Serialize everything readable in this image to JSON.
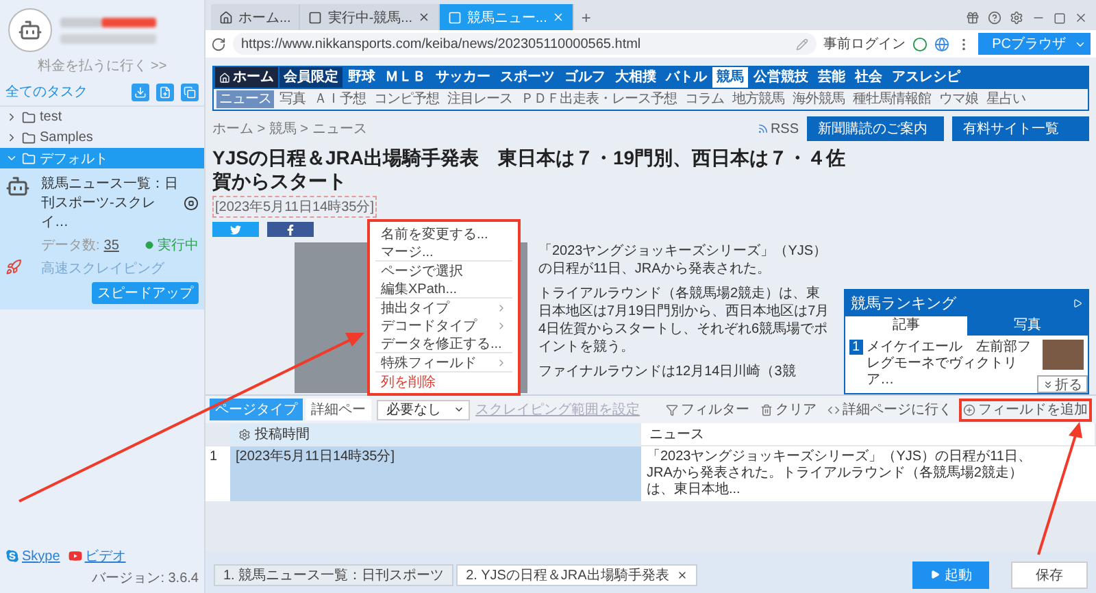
{
  "sidebar": {
    "account": {
      "link": "料金を払うに行く >>"
    },
    "task_header": {
      "title": "全てのタスク"
    },
    "tree": [
      {
        "label": "test",
        "expanded": false,
        "selected": false
      },
      {
        "label": "Samples",
        "expanded": false,
        "selected": false
      },
      {
        "label": "デフォルト",
        "expanded": true,
        "selected": true
      }
    ],
    "task": {
      "name": "競馬ニュース一覧：日刊スポーツ-スクレイ…",
      "data_label": "データ数:",
      "data_count": "35",
      "status": "実行中",
      "mode": "高速スクレイピング",
      "boost_button": "スピードアップ"
    },
    "footer": {
      "links": [
        {
          "label": "Skype",
          "kind": "skype"
        },
        {
          "label": "ビデオ",
          "kind": "video"
        }
      ],
      "version": "バージョン: 3.6.4"
    }
  },
  "browser": {
    "tabs": [
      {
        "label": "ホーム...",
        "kind": "home",
        "selected": false,
        "closable": false
      },
      {
        "label": "実行中-競馬...",
        "kind": "page",
        "selected": false,
        "closable": true
      },
      {
        "label": "競馬ニュー...",
        "kind": "page",
        "selected": true,
        "closable": true
      }
    ],
    "new_tab": "+",
    "url": "https://www.nikkansports.com/keiba/news/202305110000565.html",
    "prelogin": "事前ログイン",
    "mode_button": "PCブラウザ"
  },
  "article": {
    "nav_main": [
      {
        "label": "ホーム",
        "kind": "home",
        "selected": false
      },
      {
        "label": "会員限定",
        "kind": "member",
        "selected": false
      },
      {
        "label": "野球",
        "kind": "plain",
        "selected": false
      },
      {
        "label": "ＭＬＢ",
        "kind": "plain",
        "selected": false
      },
      {
        "label": "サッカー",
        "kind": "plain",
        "selected": false
      },
      {
        "label": "スポーツ",
        "kind": "plain",
        "selected": false
      },
      {
        "label": "ゴルフ",
        "kind": "plain",
        "selected": false
      },
      {
        "label": "大相撲",
        "kind": "plain",
        "selected": false
      },
      {
        "label": "バトル",
        "kind": "plain",
        "selected": false
      },
      {
        "label": "競馬",
        "kind": "plain",
        "selected": true
      },
      {
        "label": "公営競技",
        "kind": "plain",
        "selected": false
      },
      {
        "label": "芸能",
        "kind": "plain",
        "selected": false
      },
      {
        "label": "社会",
        "kind": "plain",
        "selected": false
      },
      {
        "label": "アスレシピ",
        "kind": "plain",
        "selected": false
      }
    ],
    "nav_sub": [
      {
        "label": "ニュース",
        "selected": true
      },
      {
        "label": "写真",
        "selected": false
      },
      {
        "label": "ＡＩ予想",
        "selected": false
      },
      {
        "label": "コンピ予想",
        "selected": false
      },
      {
        "label": "注目レース",
        "selected": false
      },
      {
        "label": "ＰＤＦ出走表・レース予想",
        "selected": false
      },
      {
        "label": "コラム",
        "selected": false
      },
      {
        "label": "地方競馬",
        "selected": false
      },
      {
        "label": "海外競馬",
        "selected": false
      },
      {
        "label": "種牡馬情報館",
        "selected": false
      },
      {
        "label": "ウマ娘",
        "selected": false
      },
      {
        "label": "星占い",
        "selected": false
      }
    ],
    "breadcrumb": "ホーム > 競馬 > ニュース",
    "rss": "RSS",
    "promo_links": [
      "新聞購読のご案内",
      "有料サイト一覧"
    ],
    "title": "YJSの日程＆JRA出場騎手発表　東日本は７・19門別、西日本は７・４佐賀からスタート",
    "date": "[2023年5月11日14時35分]",
    "paragraphs": [
      "「2023ヤングジョッキーズシリーズ」（YJS）の日程が11日、JRAから発表された。",
      "トライアルラウンド（各競馬場2競走）は、東日本地区は7月19日門別から、西日本地区は7月4日佐賀からスタートし、それぞれ6競馬場でポイントを競う。",
      "ファイナルラウンドは12月14日川崎（3競"
    ],
    "ranking": {
      "title": "競馬ランキング",
      "tabs": [
        {
          "label": "記事",
          "selected": true
        },
        {
          "label": "写真",
          "selected": false
        }
      ],
      "items": [
        {
          "rank": "1",
          "title": "メイケイエール　左前部フレグモーネでヴィクトリア…"
        }
      ]
    }
  },
  "context_menu": {
    "highlighted": true,
    "groups": [
      [
        {
          "label": "名前を変更する...",
          "submenu": false,
          "danger": false
        },
        {
          "label": "マージ...",
          "submenu": false,
          "danger": false
        }
      ],
      [
        {
          "label": "ページで選択",
          "submenu": false,
          "danger": false
        },
        {
          "label": "編集XPath...",
          "submenu": false,
          "danger": false
        }
      ],
      [
        {
          "label": "抽出タイプ",
          "submenu": true,
          "danger": false
        },
        {
          "label": "デコードタイプ",
          "submenu": true,
          "danger": false
        },
        {
          "label": "データを修正する...",
          "submenu": false,
          "danger": false
        }
      ],
      [
        {
          "label": "特殊フィールド",
          "submenu": true,
          "danger": false
        }
      ],
      [
        {
          "label": "列を削除",
          "submenu": false,
          "danger": true
        }
      ]
    ]
  },
  "panel": {
    "page_types": [
      {
        "label": "ページタイプ",
        "selected": true
      },
      {
        "label": "詳細ペー",
        "selected": false
      }
    ],
    "select": "必要なし",
    "range_link": {
      "label": "スクレイピング範囲を設定",
      "disabled": true
    },
    "actions": [
      {
        "label": "フィルター",
        "kind": "filter",
        "highlighted": false
      },
      {
        "label": "クリア",
        "kind": "clear",
        "highlighted": false
      },
      {
        "label": "詳細ページに行く",
        "kind": "goto",
        "highlighted": false
      },
      {
        "label": "フィールドを追加",
        "kind": "add",
        "highlighted": true
      }
    ],
    "collapse": "折る",
    "columns": [
      {
        "label": "投稿時間",
        "selected": true
      },
      {
        "label": "ニュース",
        "selected": false
      }
    ],
    "rows": [
      {
        "index": "1",
        "cells": [
          "[2023年5月11日14時35分]",
          "「2023ヤングジョッキーズシリーズ」（YJS）の日程が11日、JRAから発表された。トライアルラウンド（各競馬場2競走）は、東日本地..."
        ]
      }
    ]
  },
  "steps": [
    {
      "label": "1. 競馬ニュース一覧：日刊スポーツ",
      "selected": false,
      "closable": false
    },
    {
      "label": "2. YJSの日程＆JRA出場騎手発表",
      "selected": true,
      "closable": true
    }
  ],
  "start_button": "起動",
  "save_button": "保存"
}
